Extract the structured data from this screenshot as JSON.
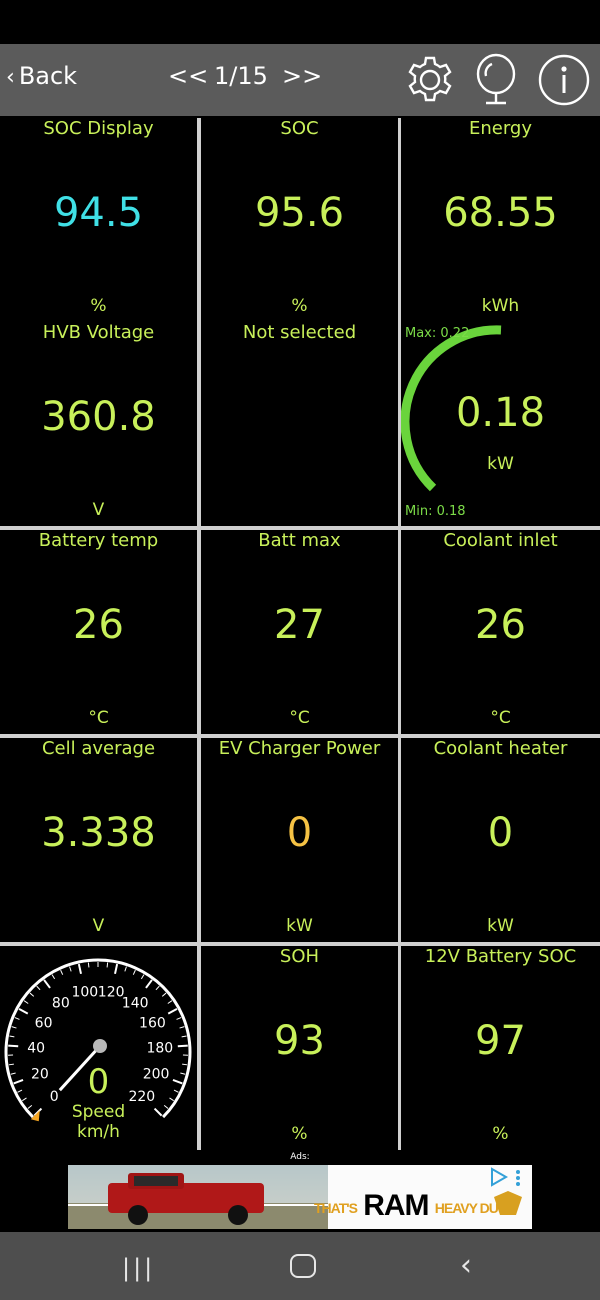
{
  "toolbar": {
    "back_label": "Back",
    "prev_label": "<<",
    "page_indicator": "1/15",
    "next_label": ">>",
    "icons": [
      "gear-icon",
      "lamp-icon",
      "info-icon"
    ]
  },
  "tiles": [
    {
      "title": "SOC Display",
      "value": "94.5",
      "unit": "%"
    },
    {
      "title": "SOC",
      "value": "95.6",
      "unit": "%"
    },
    {
      "title": "Energy",
      "value": "68.55",
      "unit": "kWh"
    },
    {
      "title": "HVB Voltage",
      "value": "360.8",
      "unit": "V"
    },
    {
      "title": "Not selected",
      "value": "",
      "unit": ""
    },
    {
      "title": "",
      "value": "0.18",
      "unit": "kW",
      "max_label": "Max: 0.22",
      "min_label": "Min: 0.18"
    },
    {
      "title": "Battery temp",
      "value": "26",
      "unit": "°C"
    },
    {
      "title": "Batt max",
      "value": "27",
      "unit": "°C"
    },
    {
      "title": "Coolant inlet",
      "value": "26",
      "unit": "°C"
    },
    {
      "title": "Cell average",
      "value": "3.338",
      "unit": "V"
    },
    {
      "title": "EV Charger Power",
      "value": "0",
      "unit": "kW"
    },
    {
      "title": "Coolant heater",
      "value": "0",
      "unit": "kW"
    },
    {
      "title": "",
      "value": "0",
      "unit": "",
      "speed_label": "Speed",
      "speed_unit": "km/h",
      "ticks": [
        "0",
        "20",
        "40",
        "60",
        "80",
        "100",
        "120",
        "140",
        "160",
        "180",
        "200",
        "220"
      ]
    },
    {
      "title": "SOH",
      "value": "93",
      "unit": "%"
    },
    {
      "title": "12V Battery SOC",
      "value": "97",
      "unit": "%"
    }
  ],
  "ads": {
    "label": "Ads:",
    "text_prefix": "THAT'S",
    "text_brand": "RAM",
    "text_suffix": "HEAVY DUTY"
  },
  "colors": {
    "value_default": "#c8f05a",
    "value_cyan": "#40e0e6",
    "value_orange": "#f5c244",
    "gauge_green": "#6ad43c"
  }
}
